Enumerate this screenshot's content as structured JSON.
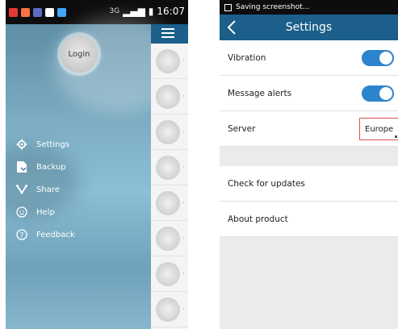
{
  "left": {
    "statusbar": {
      "time": "16:07",
      "network": "3G"
    },
    "login_label": "Login",
    "menu": [
      {
        "label": "Settings",
        "icon": "gear-icon"
      },
      {
        "label": "Backup",
        "icon": "backup-icon"
      },
      {
        "label": "Share",
        "icon": "share-icon"
      },
      {
        "label": "Help",
        "icon": "help-icon"
      },
      {
        "label": "Feedback",
        "icon": "feedback-icon"
      }
    ],
    "device_rows": 8
  },
  "right": {
    "statusbar": {
      "text": "Saving screenshot..."
    },
    "header": {
      "title": "Settings"
    },
    "rows": {
      "vibration": "Vibration",
      "message_alerts": "Message alerts",
      "server": "Server",
      "server_value": "Europe",
      "check_updates": "Check for updates",
      "about": "About product"
    },
    "toggles": {
      "vibration": true,
      "message_alerts": true
    }
  },
  "colors": {
    "header": "#1b5f8a",
    "toggle_on": "#2b84cc",
    "highlight": "#d9534f"
  }
}
